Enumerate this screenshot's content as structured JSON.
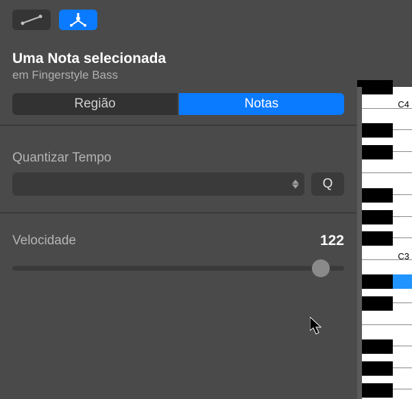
{
  "header": {
    "title": "Uma Nota selecionada",
    "subtitle": "em Fingerstyle Bass"
  },
  "tabs": {
    "region": "Região",
    "notes": "Notas"
  },
  "quantize": {
    "label": "Quantizar Tempo",
    "q_button": "Q"
  },
  "velocity": {
    "label": "Velocidade",
    "value": "122",
    "slider_percent": 93
  },
  "piano": {
    "labels": {
      "c4": "C4",
      "c3": "C3"
    }
  }
}
